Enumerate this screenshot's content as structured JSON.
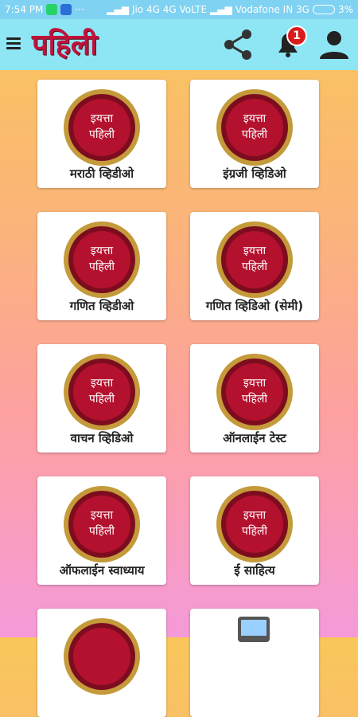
{
  "status_bar": {
    "time": "7:54 PM",
    "carrier1": "Jio 4G  4G  VoLTE",
    "carrier2": "Vodafone IN 3G",
    "battery": "3%"
  },
  "header": {
    "title": "पहिली",
    "notification_count": "1",
    "share_icon": "share-icon",
    "bell_icon": "bell-icon",
    "user_icon": "user-icon",
    "accent_color": "#c0123a"
  },
  "logo": {
    "line1": "इयत्ता",
    "line2": "पहिली"
  },
  "cards": [
    {
      "label": "मराठी व्हिडीओ"
    },
    {
      "label": "इंग्रजी व्हिडिओ"
    },
    {
      "label": "गणित व्हिडीओ"
    },
    {
      "label": "गणित व्हिडिओ (सेमी)"
    },
    {
      "label": "वाचन  व्हिडिओ"
    },
    {
      "label": "ऑनलाईन टेस्ट"
    },
    {
      "label": "ऑफलाईन स्वाध्याय"
    },
    {
      "label": "ई साहित्य"
    },
    {
      "label": ""
    },
    {
      "label": ""
    }
  ]
}
